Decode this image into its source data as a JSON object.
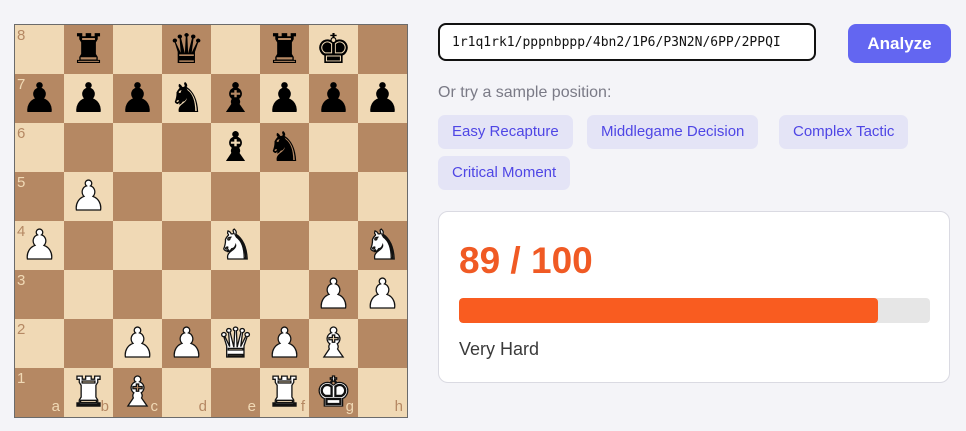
{
  "board": {
    "ranks": [
      "8",
      "7",
      "6",
      "5",
      "4",
      "3",
      "2",
      "1"
    ],
    "files": [
      "a",
      "b",
      "c",
      "d",
      "e",
      "f",
      "g",
      "h"
    ],
    "position": [
      [
        "",
        "r",
        "",
        "q",
        "",
        "r",
        "k",
        ""
      ],
      [
        "p",
        "p",
        "p",
        "n",
        "b",
        "p",
        "p",
        "p"
      ],
      [
        "",
        "",
        "",
        "",
        "b",
        "n",
        "",
        ""
      ],
      [
        "",
        "P",
        "",
        "",
        "",
        "",
        "",
        ""
      ],
      [
        "P",
        "",
        "",
        "",
        "N",
        "",
        "",
        "N"
      ],
      [
        "",
        "",
        "",
        "",
        "",
        "",
        "P",
        "P"
      ],
      [
        "",
        "",
        "P",
        "P",
        "Q",
        "P",
        "B",
        ""
      ],
      [
        "",
        "R",
        "B",
        "",
        "",
        "R",
        "K",
        ""
      ]
    ]
  },
  "fen_input": {
    "value": "1r1q1rk1/pppnbppp/4bn2/1P6/P3N2N/6PP/2PPQI"
  },
  "analyze_button": {
    "label": "Analyze"
  },
  "samples": {
    "label": "Or try a sample position:",
    "items": [
      "Easy Recapture",
      "Middlegame Decision",
      "Complex Tactic",
      "Critical Moment"
    ]
  },
  "result": {
    "score_text": "89 / 100",
    "score": 89,
    "max": 100,
    "level": "Very Hard"
  },
  "colors": {
    "accent": "#6366f1",
    "score": "#f05a24",
    "bar": "#f95c20",
    "light_square": "#f0d9b5",
    "dark_square": "#b58863"
  }
}
